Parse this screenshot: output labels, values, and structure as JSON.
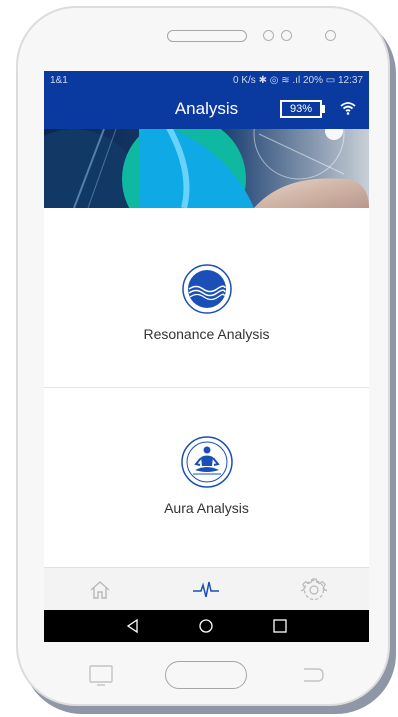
{
  "statusbar": {
    "carrier": "1&1",
    "indicators": "0 K/s ✱ ◎ ≋ .ıl 20% ▭ 12:37"
  },
  "appbar": {
    "title": "Analysis",
    "battery_label": "93%",
    "wifi_icon": "wifi-icon"
  },
  "cards": [
    {
      "label": "Resonance Analysis",
      "icon": "resonance-wave-icon"
    },
    {
      "label": "Aura Analysis",
      "icon": "meditation-figure-icon"
    }
  ],
  "tabs": [
    {
      "icon": "home-icon",
      "active": false
    },
    {
      "icon": "pulse-icon",
      "active": true
    },
    {
      "icon": "gear-icon",
      "active": false
    }
  ],
  "colors": {
    "primary": "#0a3aa0",
    "icon_blue": "#1a4fb8",
    "tab_inactive": "#b8b8b8"
  }
}
